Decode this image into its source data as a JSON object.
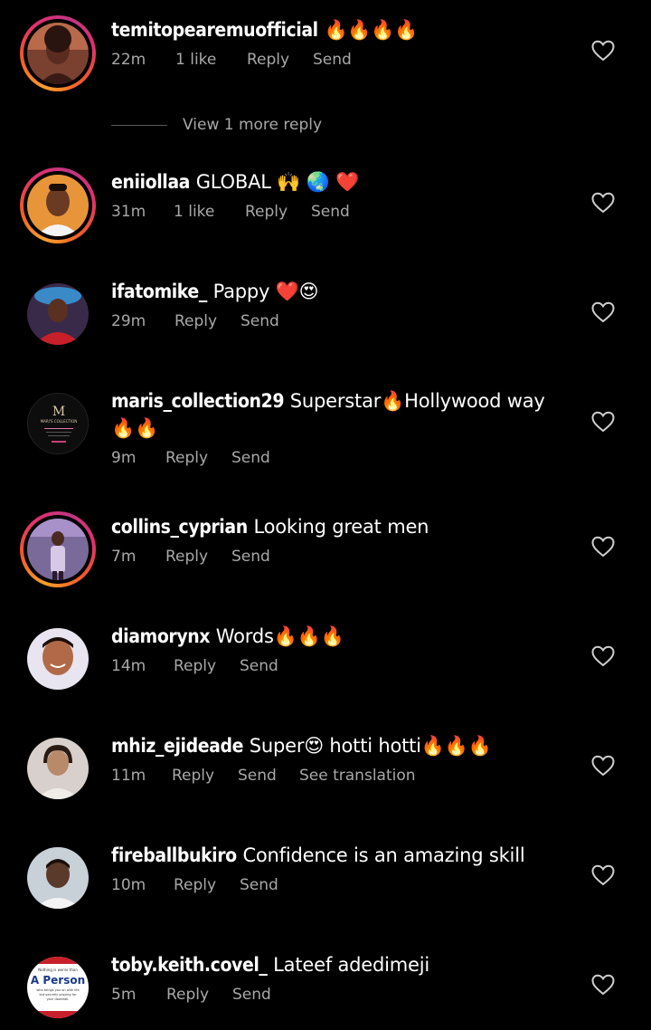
{
  "comments": [
    {
      "username": "temitopearemuofficial",
      "text": "🔥🔥🔥🔥",
      "time": "22m",
      "likes": "1 like",
      "reply": "Reply",
      "send": "Send",
      "translate": "",
      "has_story_ring": true,
      "avatar_color": "#6b3a2e"
    },
    {
      "username": "eniiollaa",
      "text": "GLOBAL 🙌 🌏 ❤️",
      "time": "31m",
      "likes": "1 like",
      "reply": "Reply",
      "send": "Send",
      "translate": "",
      "has_story_ring": true,
      "avatar_color": "#d98a3a"
    },
    {
      "username": "ifatomike_",
      "text": "Pappy ❤️😍",
      "time": "29m",
      "likes": "",
      "reply": "Reply",
      "send": "Send",
      "translate": "",
      "has_story_ring": false,
      "avatar_color": "#b8232e"
    },
    {
      "username": "maris_collection29",
      "text": "Superstar🔥Hollywood way🔥🔥",
      "time": "9m",
      "likes": "",
      "reply": "Reply",
      "send": "Send",
      "translate": "",
      "has_story_ring": false,
      "avatar_color": "#111111"
    },
    {
      "username": "collins_cyprian",
      "text": "Looking great men",
      "time": "7m",
      "likes": "",
      "reply": "Reply",
      "send": "Send",
      "translate": "",
      "has_story_ring": true,
      "avatar_color": "#8a6a9a"
    },
    {
      "username": "diamorynx",
      "text": "Words🔥🔥🔥",
      "time": "14m",
      "likes": "",
      "reply": "Reply",
      "send": "Send",
      "translate": "",
      "has_story_ring": false,
      "avatar_color": "#c98a6a"
    },
    {
      "username": "mhiz_ejideade",
      "text": "Super😍 hotti hotti🔥🔥🔥",
      "time": "11m",
      "likes": "",
      "reply": "Reply",
      "send": "Send",
      "translate": "See translation",
      "has_story_ring": false,
      "avatar_color": "#d8c8c0"
    },
    {
      "username": "fireballbukiro",
      "text": "Confidence is an amazing skill",
      "time": "10m",
      "likes": "",
      "reply": "Reply",
      "send": "Send",
      "translate": "",
      "has_story_ring": false,
      "avatar_color": "#9aa8b8"
    },
    {
      "username": "toby.keith.covel_",
      "text": "Lateef adedimeji",
      "time": "5m",
      "likes": "",
      "reply": "Reply",
      "send": "Send",
      "translate": "",
      "has_story_ring": false,
      "avatar_color": "#ffffff"
    }
  ],
  "view_more": "View 1 more reply",
  "maris_logo": {
    "monogram": "M",
    "title": "MARI'S COLLECTION"
  },
  "toby_avatar": {
    "line1": "Nothing is worse than",
    "line2": "A Person",
    "line3": "who brings you on with life",
    "line4": "but secretly praying for",
    "line5": "your downfall."
  },
  "colors": {
    "background": "#000000",
    "text": "#ffffff",
    "meta": "#a8a8a8",
    "divider": "#5a5a5a"
  }
}
